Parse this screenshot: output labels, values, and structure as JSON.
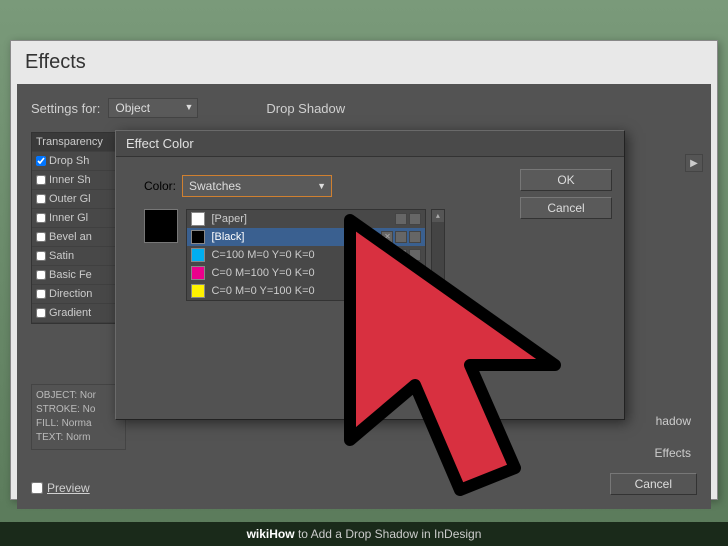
{
  "effectsDialog": {
    "title": "Effects",
    "settingsLabel": "Settings for:",
    "settingsValue": "Object",
    "sectionLabel": "Drop Shadow",
    "listHeader": "Transparency",
    "list": [
      "Drop Sh",
      "Inner Sh",
      "Outer Gl",
      "Inner Gl",
      "Bevel an",
      "Satin",
      "Basic Fe",
      "Direction",
      "Gradient"
    ],
    "checked": [
      true,
      false,
      false,
      false,
      false,
      false,
      false,
      false,
      false
    ],
    "objectInfo": [
      "OBJECT: Nor",
      "STROKE: No",
      "FILL: Norma",
      "TEXT: Norm"
    ],
    "previewLabel": "Preview",
    "cancelLabel": "Cancel",
    "rightLabels": [
      "hadow",
      "Effects"
    ]
  },
  "colorDialog": {
    "title": "Effect Color",
    "colorLabel": "Color:",
    "colorSelectValue": "Swatches",
    "okLabel": "OK",
    "cancelLabel": "Cancel",
    "swatches": [
      {
        "name": "[Paper]",
        "color": "#ffffff",
        "selected": false
      },
      {
        "name": "[Black]",
        "color": "#000000",
        "selected": true
      },
      {
        "name": "C=100 M=0 Y=0 K=0",
        "color": "#00aeef",
        "selected": false
      },
      {
        "name": "C=0 M=100 Y=0 K=0",
        "color": "#ec008c",
        "selected": false
      },
      {
        "name": "C=0 M=0 Y=100 K=0",
        "color": "#fff200",
        "selected": false
      }
    ]
  },
  "footer": {
    "brand": "wikiHow",
    "text": " to Add a Drop Shadow in InDesign"
  }
}
